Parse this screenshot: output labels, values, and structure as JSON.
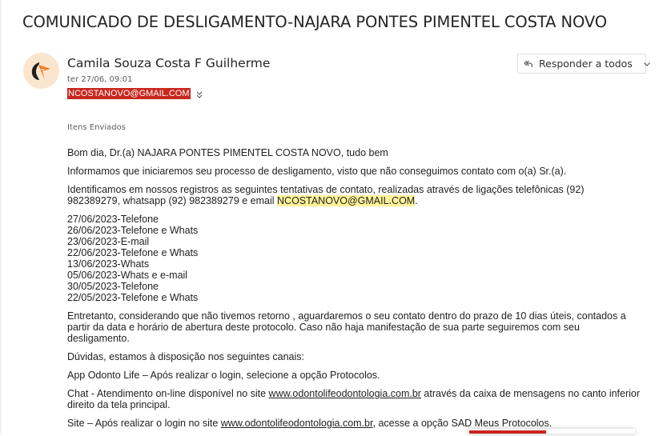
{
  "subject": "COMUNICADO DE DESLIGAMENTO-NAJARA PONTES PIMENTEL COSTA NOVO",
  "sender": {
    "name": "Camila Souza Costa F Guilherme",
    "date": "ter 27/06, 09:01"
  },
  "recipient": {
    "email": "NCOSTANOVO@GMAIL.COM"
  },
  "actions": {
    "reply_all_label": "Responder a todos"
  },
  "folder": "Itens Enviados",
  "body": {
    "greeting": "Bom dia, Dr.(a) NAJARA PONTES PIMENTEL COSTA NOVO, tudo bem",
    "intro": "Informamos que iniciaremos seu processo de desligamento, visto que não conseguimos contato com o(a) Sr.(a).",
    "attempts_text_1": "Identificamos em nossos registros as seguintes tentativas de contato, realizadas através de ligações telefônicas (92)",
    "attempts_text_2": "982389279, whatsapp (92) 982389279 e email ",
    "attempts_email": "NCOSTANOVO@GMAIL.COM",
    "attempts_text_end": ".",
    "contacts": [
      "27/06/2023-Telefone",
      "26/06/2023-Telefone e Whats",
      "23/06/2023-E-mail",
      "22/06/2023-Telefone e Whats",
      "13/06/2023-Whats",
      "05/06/2023-Whats e e-mail",
      "30/05/2023-Telefone",
      "22/05/2023-Telefone e Whats"
    ],
    "notice_1": "Entretanto, considerando que não tivemos retorno , aguardaremos o seu contato dentro do prazo de 10 dias úteis, contados a",
    "notice_2": "partir da data e horário de abertura deste protocolo. Caso não haja manifestação de sua parte seguiremos com seu",
    "notice_3": "desligamento.",
    "channels_intro": "Dúvidas, estamos à disposição nos seguintes canais:",
    "app_channel": "App Odonto Life – Após realizar o login, selecione a opção Protocolos.",
    "chat_prefix": "Chat - Atendimento on-line disponível no site ",
    "chat_link": "www.odontolifeodontologia.com.br",
    "chat_suffix_1": " através da caixa de mensagens no canto inferior",
    "chat_suffix_2": "direito da tela principal.",
    "site_prefix": "Site – Após realizar o login no site ",
    "site_link": "www.odontolifeodontologia.com.br",
    "site_suffix": ", acesse a opção SAD Meus Protocolos."
  },
  "colors": {
    "accent_red": "#c9271f",
    "highlight": "#fff39a",
    "avatar_bg": "#fbe5cf",
    "logo_orange": "#f07a1c"
  },
  "icons": {
    "avatar": "odontolife-logo",
    "expand": "double-chevron-down-icon",
    "reply": "reply-all-icon",
    "menu": "chevron-down-icon"
  }
}
